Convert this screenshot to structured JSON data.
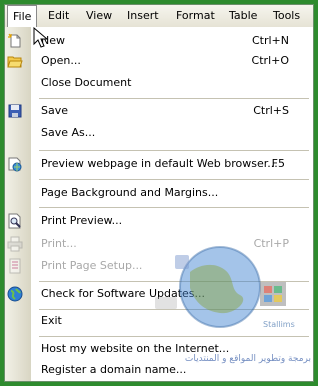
{
  "menubar": {
    "items": [
      "File",
      "Edit",
      "View",
      "Insert",
      "Format",
      "Table",
      "Tools"
    ],
    "open": "File"
  },
  "file_menu": [
    {
      "label": "New",
      "shortcut": "Ctrl+N",
      "icon": "new-document-icon",
      "enabled": true
    },
    {
      "label": "Open...",
      "shortcut": "Ctrl+O",
      "icon": "open-folder-icon",
      "enabled": true
    },
    {
      "label": "Close Document",
      "shortcut": "",
      "icon": "",
      "enabled": true
    },
    {
      "label": "Save",
      "shortcut": "Ctrl+S",
      "icon": "save-floppy-icon",
      "enabled": true
    },
    {
      "label": "Save As...",
      "shortcut": "",
      "icon": "",
      "enabled": true
    },
    {
      "label": "Preview webpage in default Web browser...",
      "shortcut": "F5",
      "icon": "preview-browser-icon",
      "enabled": true
    },
    {
      "label": "Page Background and Margins...",
      "shortcut": "",
      "icon": "",
      "enabled": true
    },
    {
      "label": "Print Preview...",
      "shortcut": "",
      "icon": "print-preview-icon",
      "enabled": true
    },
    {
      "label": "Print...",
      "shortcut": "Ctrl+P",
      "icon": "printer-icon",
      "enabled": false
    },
    {
      "label": "Print Page Setup...",
      "shortcut": "",
      "icon": "page-setup-icon",
      "enabled": false
    },
    {
      "label": "Check for Software Updates...",
      "shortcut": "",
      "icon": "globe-icon",
      "enabled": true
    },
    {
      "label": "Exit",
      "shortcut": "",
      "icon": "",
      "enabled": true
    },
    {
      "label": "Host my website on the Internet...",
      "shortcut": "",
      "icon": "",
      "enabled": true
    },
    {
      "label": "Register a domain name...",
      "shortcut": "",
      "icon": "",
      "enabled": true
    }
  ],
  "watermark": {
    "text": "برمجة وتطوير المواقع و المنتديات",
    "logo_name": "Stallims"
  },
  "colors": {
    "frame": "#2e8b2e",
    "gutter": "#e4e2d6",
    "disabled_text": "#a8a8a8"
  }
}
